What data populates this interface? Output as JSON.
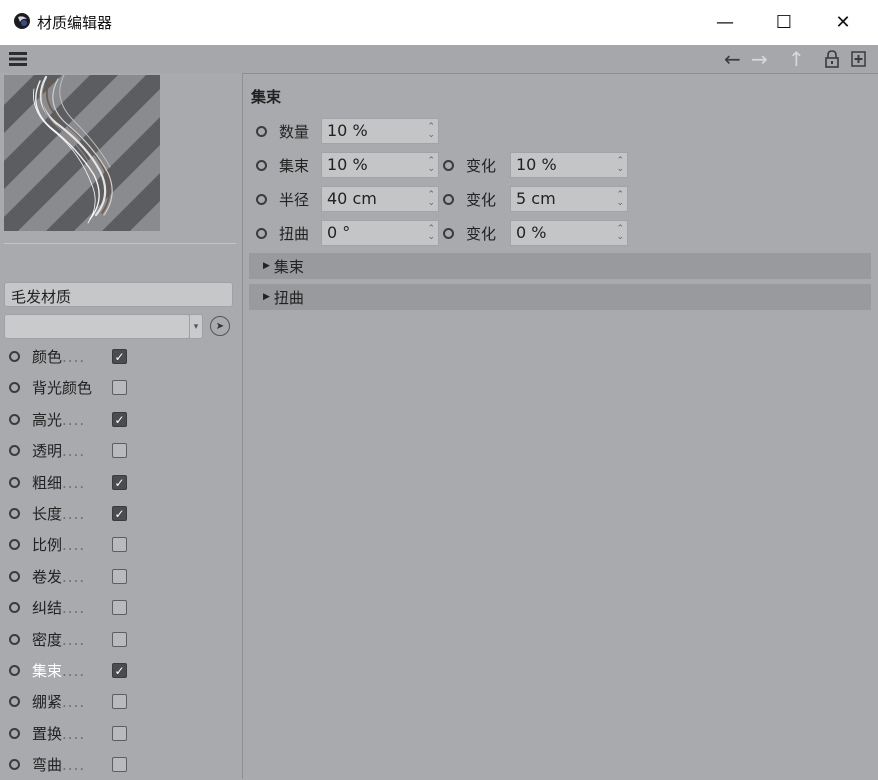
{
  "window": {
    "title": "材质编辑器",
    "controls": {
      "minimize": "—",
      "maximize": "☐",
      "close": "✕"
    }
  },
  "toolbar": {
    "icons": [
      "menu-icon",
      "back-arrow-icon",
      "forward-arrow-icon",
      "up-arrow-icon",
      "lock-icon",
      "new-window-icon"
    ]
  },
  "material": {
    "name": "毛发材质",
    "dropdown_value": ""
  },
  "channels": [
    {
      "label": "颜色",
      "dots": "....",
      "checked": true,
      "active": false
    },
    {
      "label": "背光颜色",
      "dots": "",
      "checked": false,
      "active": false
    },
    {
      "label": "高光",
      "dots": "....",
      "checked": true,
      "active": false
    },
    {
      "label": "透明",
      "dots": "....",
      "checked": false,
      "active": false
    },
    {
      "label": "粗细",
      "dots": "....",
      "checked": true,
      "active": false
    },
    {
      "label": "长度",
      "dots": "....",
      "checked": true,
      "active": false
    },
    {
      "label": "比例",
      "dots": "....",
      "checked": false,
      "active": false
    },
    {
      "label": "卷发",
      "dots": "....",
      "checked": false,
      "active": false
    },
    {
      "label": "纠结",
      "dots": "....",
      "checked": false,
      "active": false
    },
    {
      "label": "密度",
      "dots": "....",
      "checked": false,
      "active": false
    },
    {
      "label": "集束",
      "dots": "....",
      "checked": true,
      "active": true
    },
    {
      "label": "绷紧",
      "dots": "....",
      "checked": false,
      "active": false
    },
    {
      "label": "置换",
      "dots": "....",
      "checked": false,
      "active": false
    },
    {
      "label": "弯曲",
      "dots": "....",
      "checked": false,
      "active": false
    }
  ],
  "section": {
    "title": "集束",
    "params": [
      {
        "label": "数量",
        "value": "10 %"
      },
      {
        "label": "集束",
        "value": "10 %",
        "variation_label": "变化",
        "variation_value": "10 %"
      },
      {
        "label": "半径",
        "value": "40 cm",
        "variation_label": "变化",
        "variation_value": "5 cm"
      },
      {
        "label": "扭曲",
        "value": "0 °",
        "variation_label": "变化",
        "variation_value": "0 %"
      }
    ],
    "subsections": [
      "集束",
      "扭曲"
    ]
  },
  "colors": {
    "background": "#a9aaad",
    "active_label": "#ffffff",
    "checkbox_on": "#4b4c4f"
  }
}
